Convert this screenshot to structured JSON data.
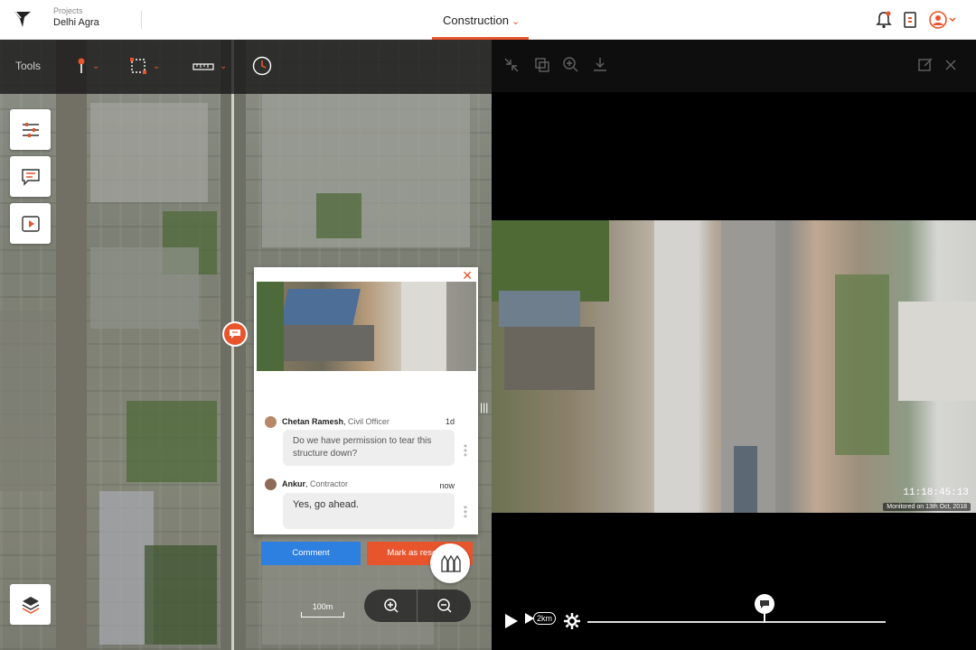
{
  "header": {
    "projects_label": "Projects",
    "project_name": "Delhi Agra",
    "center_tab": "Construction"
  },
  "tools": {
    "label": "Tools"
  },
  "comment_popup": {
    "comments": [
      {
        "author": "Chetan Ramesh",
        "role": "Civil Officer",
        "time": "1d",
        "text": "Do we have permission to tear this structure down?"
      },
      {
        "author": "Ankur",
        "role": "Contractor",
        "time": "now",
        "text": "Yes, go ahead."
      }
    ],
    "comment_button": "Comment",
    "resolve_button": "Mark as resolved"
  },
  "map": {
    "scale_label": "100m"
  },
  "video": {
    "timestamp": "11:18:45:13",
    "monitored": "Monitored on 13th Oct, 2018",
    "speed_label": "2km"
  },
  "colors": {
    "accent": "#e8542b",
    "primary_blue": "#2d7fe0"
  }
}
